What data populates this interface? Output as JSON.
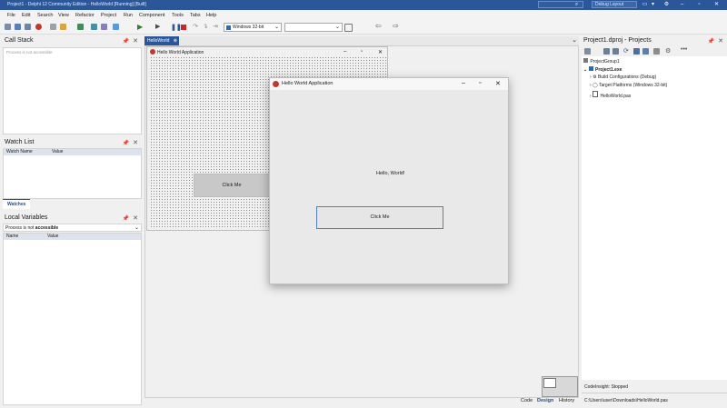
{
  "titlebar": {
    "title": "Project1 - Delphi 12 Community Edition - HelloWorld [Running] [Built]",
    "layout_combo": "Debug Layout"
  },
  "menu": [
    "File",
    "Edit",
    "Search",
    "View",
    "Refactor",
    "Project",
    "Run",
    "Component",
    "Tools",
    "Tabs",
    "Help"
  ],
  "toolbar": {
    "platform": "Windows 32-bit",
    "config": ""
  },
  "left": {
    "call_stack": {
      "title": "Call Stack",
      "message": "Process is not accessible"
    },
    "watch_list": {
      "title": "Watch List",
      "col_name": "Watch Name",
      "col_value": "Value",
      "tab": "Watches"
    },
    "local_vars": {
      "title": "Local Variables",
      "process_label": "Process is not",
      "process_bold": "accessible",
      "col_name": "Name",
      "col_value": "Value"
    }
  },
  "editor": {
    "tab": "HelloWorld",
    "design_caption": "Hello World Application",
    "design_button": "Click Me",
    "bottom_tabs": {
      "code": "Code",
      "design": "Design",
      "history": "History"
    }
  },
  "app_window": {
    "caption": "Hello World Application",
    "label": "Hello, World!",
    "button": "Click Me"
  },
  "projects": {
    "title": "Project1.dproj - Projects",
    "items": [
      {
        "label": "ProjectGroup1"
      },
      {
        "label": "Project1.exe"
      },
      {
        "label": "Build Configurations (Debug)"
      },
      {
        "label": "Target Platforms (Windows 32-bit)"
      },
      {
        "label": "HelloWorld.pas"
      }
    ],
    "status": "CodeInsight: Stopped",
    "path": "C:\\Users\\user\\Downloads\\HelloWorld.pas"
  }
}
